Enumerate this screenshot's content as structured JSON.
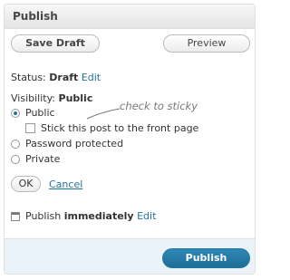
{
  "box": {
    "title": "Publish"
  },
  "buttons": {
    "save_draft": "Save Draft",
    "preview": "Preview",
    "ok": "OK",
    "cancel": "Cancel",
    "publish": "Publish"
  },
  "status": {
    "label": "Status:",
    "value": "Draft",
    "edit": "Edit"
  },
  "visibility": {
    "label": "Visibility:",
    "value": "Public",
    "options": [
      {
        "label": "Public",
        "selected": true
      },
      {
        "label": "Password protected",
        "selected": false
      },
      {
        "label": "Private",
        "selected": false
      }
    ],
    "sticky_label": "Stick this post to the front page",
    "sticky_checked": false
  },
  "annotation": "check to sticky",
  "schedule": {
    "label": "Publish",
    "value": "immediately",
    "edit": "Edit",
    "icon": "calendar-icon"
  },
  "colors": {
    "link": "#21759b",
    "publish_button": "#21759b",
    "footer_bg": "#eaf2fa"
  }
}
